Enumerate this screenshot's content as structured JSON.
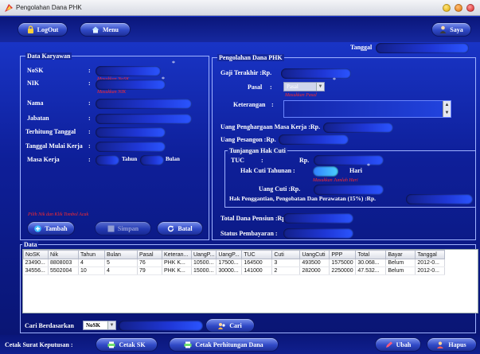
{
  "window": {
    "title": "Pengolahan Dana PHK"
  },
  "toolbar": {
    "logout_label": "LogOut",
    "menu_label": "Menu",
    "saya_label": "Saya"
  },
  "tanggal": {
    "label": "Tanggal"
  },
  "karyawan": {
    "title": "Data Karyawan",
    "nosk_label": "NoSK",
    "nik_label": "NIK",
    "nosk_hint": "Masukkan NoSK",
    "nik_hint": "Masukkan NIK",
    "nama_label": "Nama",
    "jabatan_label": "Jabatan",
    "terhitung_label": "Terhitung Tanggal",
    "mulai_label": "Tanggal Mulai Kerja",
    "masa_label": "Masa Kerja",
    "tahun_label": "Tahun",
    "bulan_label": "Bulan",
    "pilih_hint": "Pilih Nik dan Klik Tombol Acak",
    "tambah_label": "Tambah",
    "simpan_label": "Simpan",
    "batal_label": "Batal"
  },
  "phk": {
    "title": "Pengolahan Dana PHK",
    "gaji_label": "Gaji Terakhir :Rp.",
    "pasal_label": "Pasal",
    "pasal_value": "Pasal",
    "pasal_hint": "Masukkan Pasal",
    "keterangan_label": "Keterangan",
    "penghargaan_label": "Uang Penghargaan Masa Kerja :Rp.",
    "pesangon_label": "Uang Pesangon :Rp.",
    "tunjangan_title": "Tunjangan Hak Cuti",
    "tuc_label": "TUC",
    "rp_label": "Rp.",
    "hakcuti_label": "Hak Cuti Tahunan :",
    "hari_label": "Hari",
    "hakcuti_hint": "Masukkan Jumlah Hari",
    "uangcuti_label": "Uang Cuti :Rp.",
    "hakpenggantian_label": "Hak Penggantian, Pengobatan Dan Perawatan (15%) :Rp.",
    "total_label": "Total Dana Pensiun :Rp.",
    "status_label": "Status Pembayaran :"
  },
  "data": {
    "title": "Data",
    "columns": [
      "NoSK",
      "Nik",
      "Tahun",
      "Bulan",
      "Pasal",
      "Keteran...",
      "UangP...",
      "UangP...",
      "TUC",
      "Cuti",
      "UangCuti",
      "PPP",
      "Total",
      "Bayar",
      "Tanggal"
    ],
    "rows": [
      [
        "23490...",
        "8808003",
        "4",
        "5",
        "76",
        "PHK K...",
        "10500...",
        "17500...",
        "164500",
        "3",
        "493500",
        "1575000",
        "30.068...",
        "Belum",
        "2012-0..."
      ],
      [
        "34556...",
        "5502004",
        "10",
        "4",
        "79",
        "PHK K...",
        "15000...",
        "30000...",
        "141000",
        "2",
        "282000",
        "2250000",
        "47.532...",
        "Belum",
        "2012-0..."
      ]
    ]
  },
  "search": {
    "label": "Cari Berdasarkan",
    "select_value": "NoSK",
    "cari_label": "Cari"
  },
  "footer": {
    "cetak_label": "Cetak Surat Keputusan :",
    "cetaksk_label": "Cetak SK",
    "cetakperhitungan_label": "Cetak Perhitungan Dana",
    "ubah_label": "Ubah",
    "hapus_label": "Hapus"
  },
  "colors": {
    "accent": "#1f37d6",
    "hint": "#ff2b2b"
  }
}
